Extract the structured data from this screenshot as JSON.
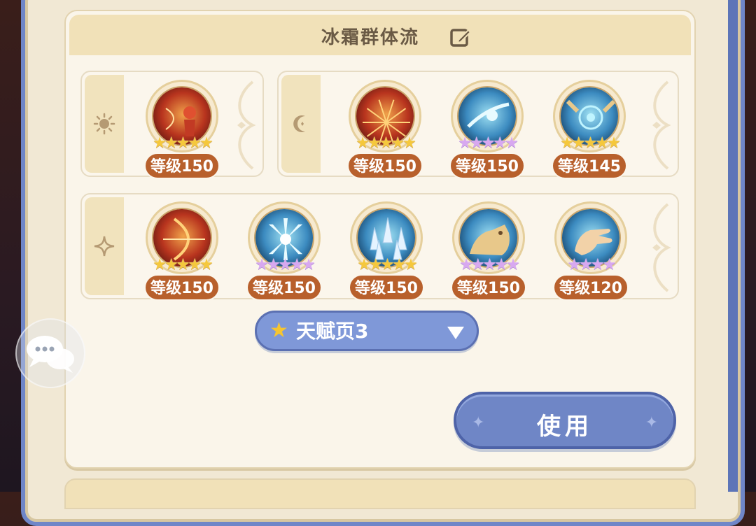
{
  "panel": {
    "title": "冰霜群体流",
    "edit_icon": "edit-icon"
  },
  "groups": [
    {
      "symbol": "sun-icon",
      "skills": [
        {
          "level": "等级150",
          "stars": "★★★★★",
          "star_color": "gold",
          "theme": "red",
          "art": "archer"
        }
      ]
    },
    {
      "symbol": "moon-icon",
      "skills": [
        {
          "level": "等级150",
          "stars": "★★★★★",
          "star_color": "gold",
          "theme": "red",
          "art": "burst"
        },
        {
          "level": "等级150",
          "stars": "★★★★★",
          "star_color": "purple",
          "theme": "blue",
          "art": "frost-sweep"
        },
        {
          "level": "等级145",
          "stars": "★★★★★",
          "star_color": "gold",
          "theme": "blue",
          "art": "portal"
        }
      ]
    },
    {
      "symbol": "sparkle-icon",
      "skills": [
        {
          "level": "等级150",
          "stars": "★★★★★",
          "star_color": "gold",
          "theme": "red",
          "art": "bow"
        },
        {
          "level": "等级150",
          "stars": "★★★★★",
          "star_color": "purple",
          "theme": "blue",
          "art": "shatter"
        },
        {
          "level": "等级150",
          "stars": "★★★★★",
          "star_color": "gold",
          "theme": "blue",
          "art": "ice-spikes"
        },
        {
          "level": "等级150",
          "stars": "★★★★★",
          "star_color": "purple",
          "theme": "blue",
          "art": "ice-beast"
        },
        {
          "level": "等级120",
          "stars": "★★★★",
          "star_color": "purple",
          "theme": "blue",
          "art": "hand"
        }
      ]
    }
  ],
  "talent_dropdown": {
    "label": "天赋页3",
    "icon": "star-icon"
  },
  "use_button": {
    "label": "使用"
  },
  "chat_button": {
    "icon": "chat-bubbles-icon"
  },
  "colors": {
    "accent_blue": "#6f86c6",
    "level_badge": "#b8602c",
    "gold_star": "#f5c83c",
    "purple_star": "#d8a8f0"
  }
}
